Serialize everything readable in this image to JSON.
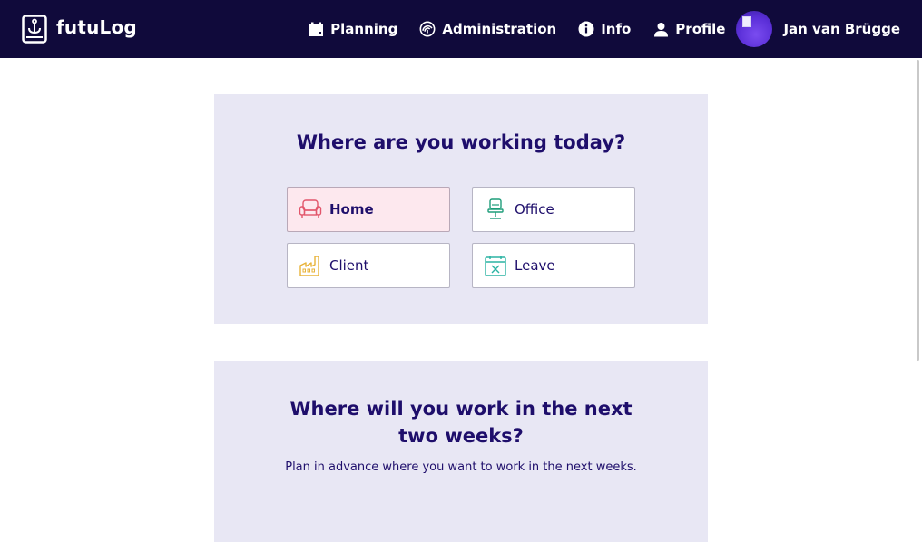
{
  "app": {
    "brand": "futuLog"
  },
  "nav": {
    "items": [
      {
        "id": "planning",
        "label": "Planning",
        "icon": "calendar-icon"
      },
      {
        "id": "administration",
        "label": "Administration",
        "icon": "fingerprint-icon"
      },
      {
        "id": "info",
        "label": "Info",
        "icon": "info-icon"
      },
      {
        "id": "profile",
        "label": "Profile",
        "icon": "person-icon"
      }
    ],
    "user_name": "Jan van Brügge"
  },
  "today": {
    "title": "Where are you working today?",
    "options": [
      {
        "label": "Home",
        "icon": "armchair-icon",
        "selected": true
      },
      {
        "label": "Office",
        "icon": "office-chair-icon",
        "selected": false
      },
      {
        "label": "Client",
        "icon": "factory-icon",
        "selected": false
      },
      {
        "label": "Leave",
        "icon": "calendar-x-icon",
        "selected": false
      }
    ]
  },
  "planning": {
    "title": "Where will you work in the next two weeks?",
    "subtitle": "Plan in advance where you want to work in the next weeks."
  },
  "colors": {
    "topbar": "#100a3b",
    "card": "#e8e7f4",
    "heading": "#1e0e6b",
    "selected": "#fde8ee"
  }
}
